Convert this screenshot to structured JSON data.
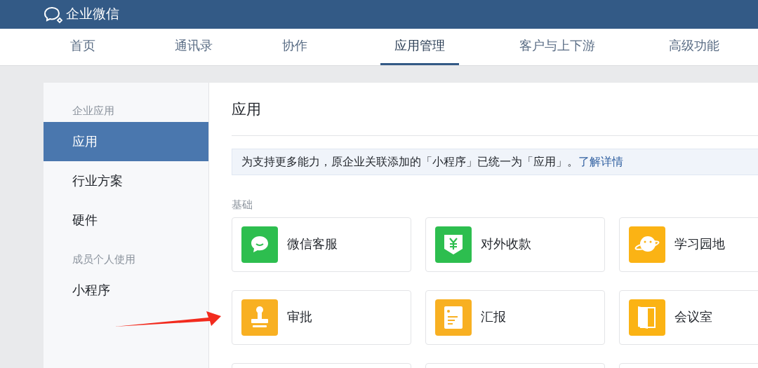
{
  "header": {
    "brand": "企业微信"
  },
  "nav": [
    {
      "label": "首页",
      "selected": false
    },
    {
      "label": "通讯录",
      "selected": false
    },
    {
      "label": "协作",
      "selected": false
    },
    {
      "label": "应用管理",
      "selected": true
    },
    {
      "label": "客户与上下游",
      "selected": false
    },
    {
      "label": "高级功能",
      "selected": false
    }
  ],
  "sidebar": [
    {
      "kind": "group",
      "label": "企业应用"
    },
    {
      "kind": "item",
      "label": "应用",
      "selected": true
    },
    {
      "kind": "item",
      "label": "行业方案",
      "selected": false
    },
    {
      "kind": "item",
      "label": "硬件",
      "selected": false
    },
    {
      "kind": "group",
      "label": "成员个人使用"
    },
    {
      "kind": "item",
      "label": "小程序",
      "selected": false
    }
  ],
  "content": {
    "title": "应用",
    "notice": {
      "text": "为支持更多能力，原企业关联添加的「小程序」已统一为「应用」。",
      "link": "了解详情"
    },
    "section": "基础",
    "apps": [
      {
        "name": "微信客服",
        "color": "#2dbe4f"
      },
      {
        "name": "对外收款",
        "color": "#2dbe4f"
      },
      {
        "name": "学习园地",
        "color": "#fbb314"
      },
      {
        "name": "审批",
        "color": "#f8b022"
      },
      {
        "name": "汇报",
        "color": "#f8b022"
      },
      {
        "name": "会议室",
        "color": "#fbb314"
      }
    ]
  }
}
